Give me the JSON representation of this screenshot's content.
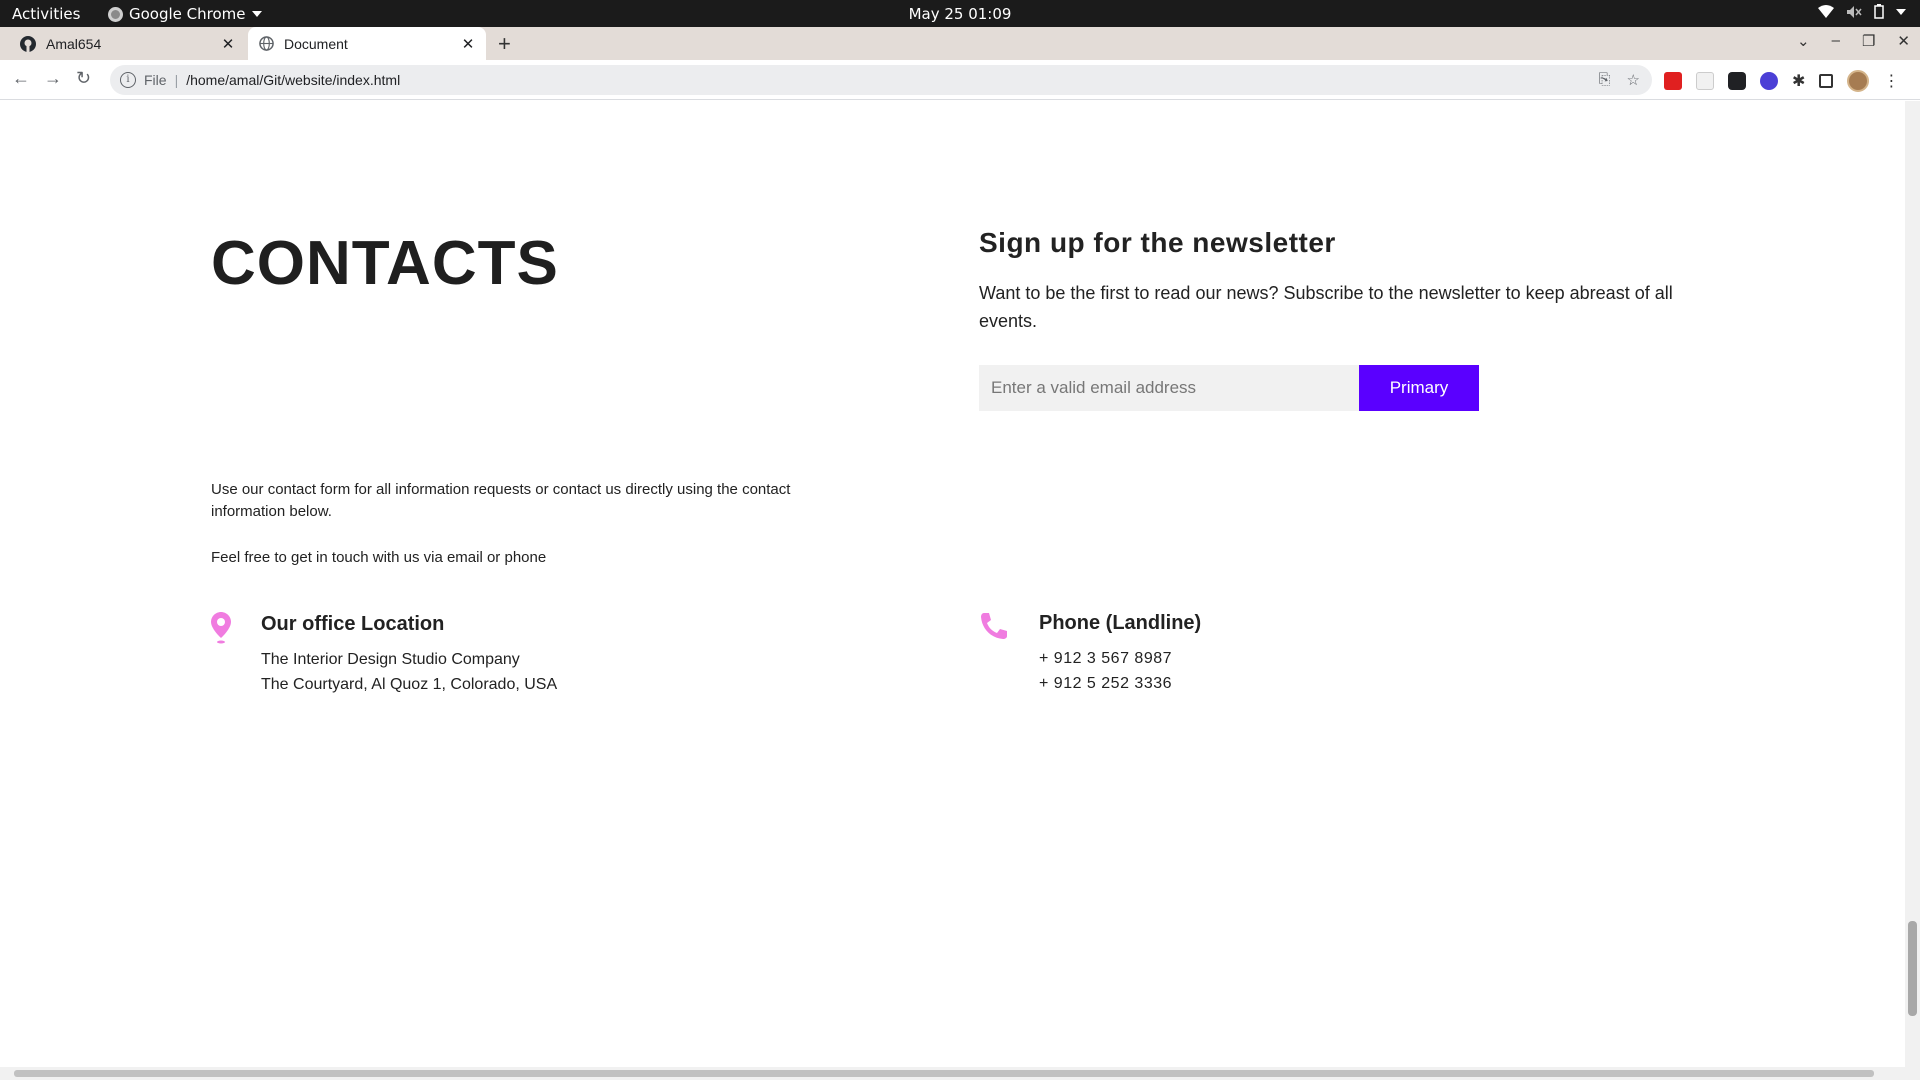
{
  "os_bar": {
    "activities": "Activities",
    "app_name": "Google Chrome",
    "clock": "May 25  01:09"
  },
  "tabs": [
    {
      "label": "Amal654",
      "icon": "github-icon",
      "active": false
    },
    {
      "label": "Document",
      "icon": "globe-icon",
      "active": true
    }
  ],
  "toolbar": {
    "scheme": "File",
    "url": "/home/amal/Git/website/index.html"
  },
  "colors": {
    "accent": "#5a00ff",
    "icon_pink": "#f07ce0"
  },
  "contacts": {
    "title": "CONTACTS",
    "intro": "Use our contact form for all information requests or contact us directly using the contact information below.",
    "touch": "Feel free to get in touch with us via email or phone",
    "office": {
      "title": "Our office Location",
      "line1": "The Interior Design Studio Company",
      "line2": "The Courtyard, Al Quoz 1, Colorado,  USA"
    },
    "phone": {
      "title": "Phone (Landline)",
      "line1": "+ 912 3 567 8987",
      "line2": "+ 912 5 252 3336"
    }
  },
  "newsletter": {
    "title": "Sign up for the newsletter",
    "text": "Want to be the first to read our news? Subscribe to the newsletter to keep abreast of all events.",
    "email_placeholder": "Enter a valid email address",
    "button_label": "Primary"
  }
}
